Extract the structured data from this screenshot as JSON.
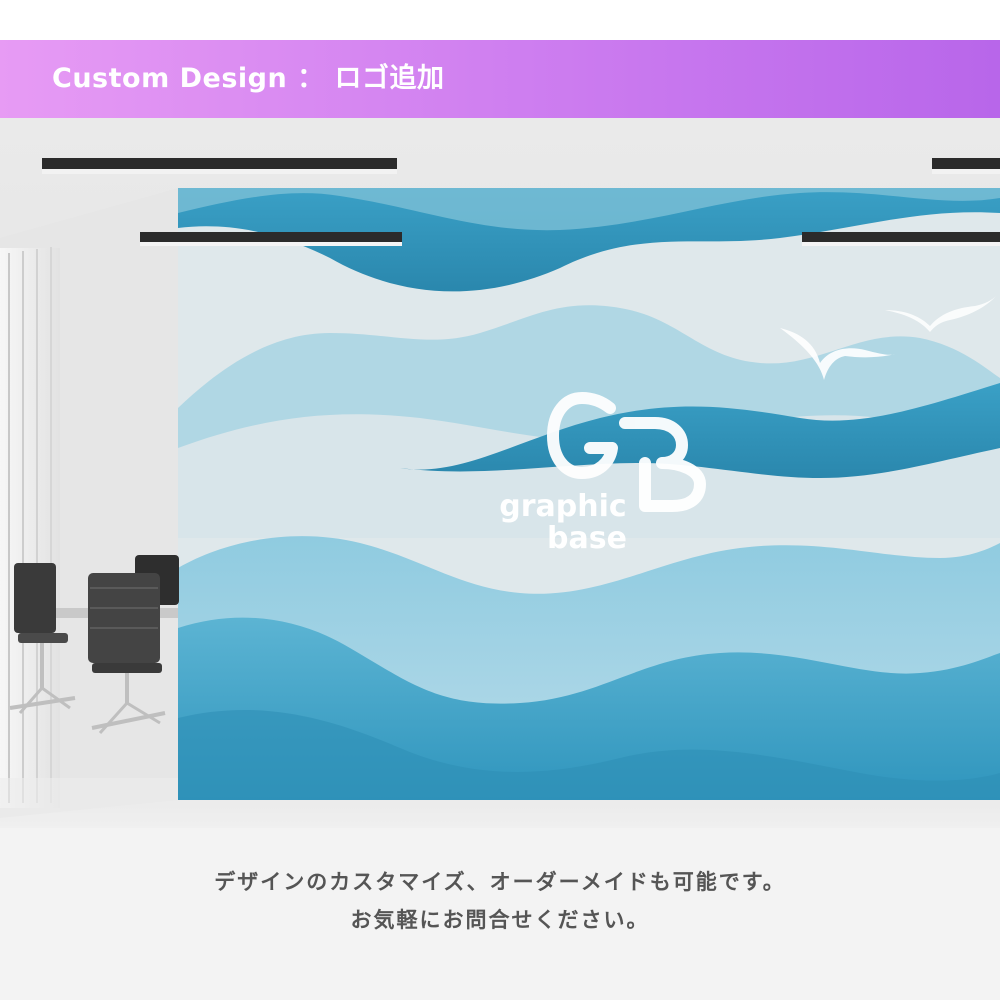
{
  "banner": {
    "title": "Custom Design ： ロゴ追加",
    "gradient_start": "#e79bf4",
    "gradient_end": "#b866ea"
  },
  "photo": {
    "scene": "office-meeting-room-mockup",
    "mural_colors": [
      "#2f93b9",
      "#7ec0d6",
      "#cde3ea",
      "#dfe8eb"
    ],
    "logo": {
      "mark": "GB",
      "text_line1": "graphic",
      "text_line2": "base"
    }
  },
  "caption": {
    "line1": "デザインのカスタマイズ、オーダーメイドも可能です。",
    "line2": "お気軽にお問合せください。"
  }
}
